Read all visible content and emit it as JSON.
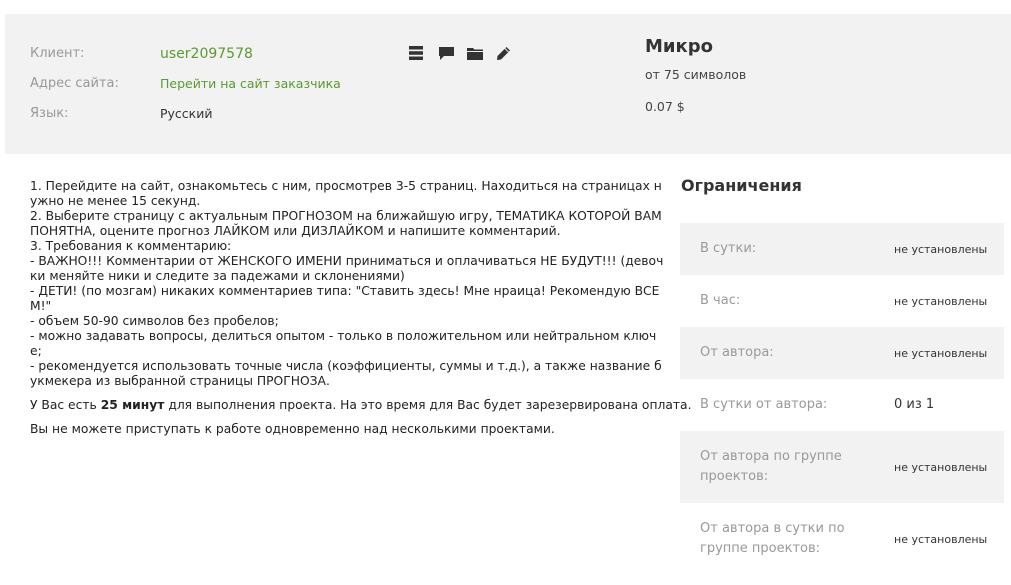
{
  "header": {
    "client_label": "Клиент:",
    "client_value": "user2097578",
    "site_label": "Адрес сайта:",
    "site_value": "Перейти на сайт заказчика",
    "lang_label": "Язык:",
    "lang_value": "Русский",
    "toolbar_icons": [
      "list-icon",
      "comment-icon",
      "folder-icon",
      "pencil-icon"
    ]
  },
  "plan": {
    "title": "Микро",
    "min_chars": "от 75 символов",
    "price": "0.07 $"
  },
  "instructions": {
    "text": "1. Перейдите на сайт, ознакомьтесь с ним, просмотрев 3-5 страниц. Находиться на страницах нужно не менее 15 секунд.\n2. Выберите страницу с актуальным ПРОГНОЗОМ на ближайшую игру, ТЕМАТИКА КОТОРОЙ ВАМ ПОНЯТНА, оцените прогноз ЛАЙКОМ или ДИЗЛАЙКОМ и напишите комментарий.\n3. Требования к комментарию:\n- ВАЖНО!!! Комментарии от ЖЕНСКОГО ИМЕНИ приниматься и оплачиваться НЕ БУДУТ!!! (девочки меняйте ники и следите за падежами и склонениями)\n- ДЕТИ! (по мозгам) никаких комментариев типа: \"Ставить здесь! Мне нраица! Рекомендую ВСЕМ!\"\n- объем 50-90 символов без пробелов;\n- можно задавать вопросы, делиться опытом - только в положительном или нейтральном ключе;\n- рекомендуется использовать точные числа (коэффициенты, суммы и т.д.), а также название букмекера из выбранной страницы ПРОГНОЗА."
  },
  "timeinfo": {
    "prefix": "У Вас есть ",
    "duration": "25 минут",
    "suffix": " для выполнения проекта. На это время для Вас будет зарезервирована оплата."
  },
  "warning": "Вы не можете приступать к работе одновременно над несколькими проектами.",
  "limits": {
    "title": "Ограничения",
    "rows": [
      {
        "name": "В сутки:",
        "value": "не установлены"
      },
      {
        "name": "В час:",
        "value": "не установлены"
      },
      {
        "name": "От автора:",
        "value": "не установлены"
      },
      {
        "name": "В сутки от автора:",
        "value": "0 из 1"
      },
      {
        "name": "От автора по группе проектов:",
        "value": "не установлены"
      },
      {
        "name": "От автора в сутки по группе проектов:",
        "value": "не установлены"
      }
    ]
  }
}
